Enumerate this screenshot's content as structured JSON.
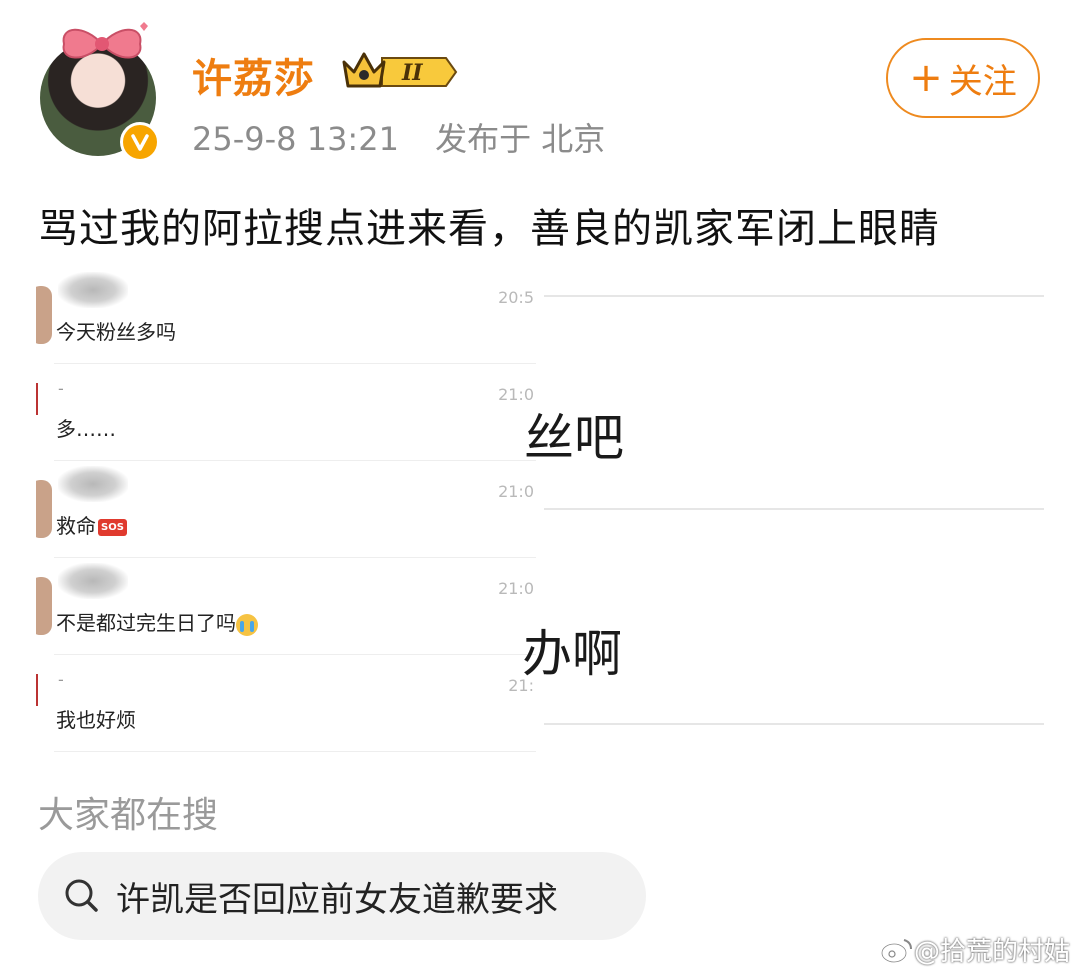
{
  "post": {
    "username": "许荔莎",
    "level_badge": "II",
    "time": "25-9-8 13:21",
    "location": "发布于 北京",
    "follow_label": "关注",
    "follow_plus": "+",
    "text": "骂过我的阿拉搜点进来看，善良的凯家军闭上眼睛"
  },
  "chat_screenshot": {
    "rows": [
      {
        "time": "20:5",
        "message": "今天粉丝多吗",
        "emoji": ""
      },
      {
        "time": "21:0",
        "message": "多……",
        "emoji": "",
        "sender": "-"
      },
      {
        "time": "21:0",
        "message": "救命",
        "emoji": "SOS"
      },
      {
        "time": "21:0",
        "message": "不是都过完生日了吗",
        "emoji": "cry-face-icon"
      },
      {
        "time": "21:",
        "message": "我也好烦",
        "emoji": "",
        "sender": "-"
      }
    ],
    "right_partial": [
      "丝吧",
      "办啊"
    ]
  },
  "search": {
    "heading": "大家都在搜",
    "query": "许凯是否回应前女友道歉要求"
  },
  "watermark": {
    "text": "@拾荒的村姑"
  },
  "colors": {
    "username": "#ee7d10",
    "follow_border": "#ee8a1f",
    "verified": "#f7a500",
    "meta": "#8b8b8b"
  }
}
